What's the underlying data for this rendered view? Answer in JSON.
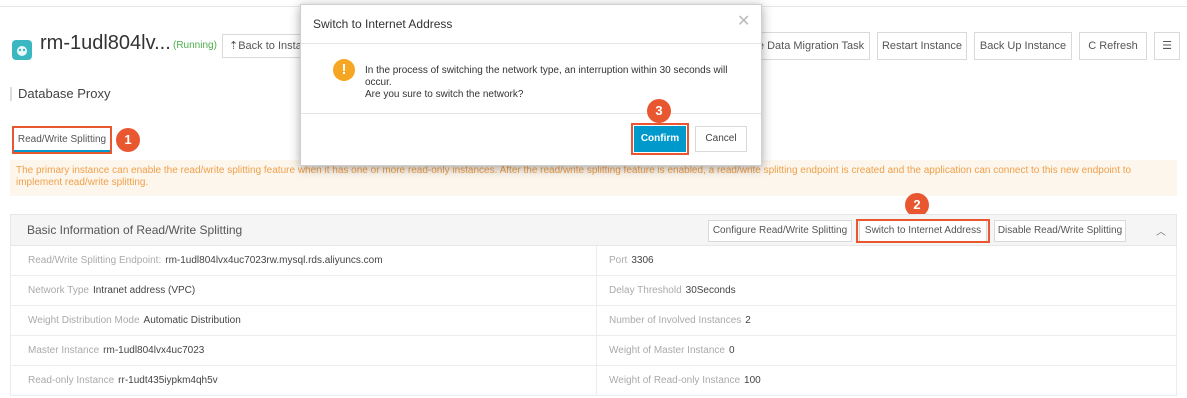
{
  "header": {
    "instance_name": "rm-1udl804lv...",
    "status": "(Running)",
    "back_label": "Back to Instances",
    "buttons": {
      "migrate": "Create Data Migration Task",
      "restart": "Restart Instance",
      "backup": "Back Up Instance",
      "refresh": "Refresh"
    }
  },
  "section": {
    "title": "Database Proxy"
  },
  "tabs": [
    {
      "label": "Read/Write Splitting"
    }
  ],
  "notice": "The primary instance can enable the read/write splitting feature when it has one or more read-only instances. After the read/write splitting feature is enabled, a read/write splitting endpoint is created and the application can connect to this new endpoint to implement read/write splitting.",
  "panel": {
    "title": "Basic Information of Read/Write Splitting",
    "buttons": {
      "configure": "Configure Read/Write Splitting",
      "switch": "Switch to Internet Address",
      "disable": "Disable Read/Write Splitting"
    },
    "rows": [
      {
        "left_label": "Read/Write Splitting Endpoint:",
        "left_value": "rm-1udl804lvx4uc7023rw.mysql.rds.aliyuncs.com",
        "right_label": "Port",
        "right_value": "3306"
      },
      {
        "left_label": "Network Type",
        "left_value": "Intranet address (VPC)",
        "right_label": "Delay Threshold",
        "right_value": "30Seconds"
      },
      {
        "left_label": "Weight Distribution Mode",
        "left_value": "Automatic Distribution",
        "right_label": "Number of Involved Instances",
        "right_value": "2"
      },
      {
        "left_label": "Master Instance",
        "left_value": "rm-1udl804lvx4uc7023",
        "right_label": "Weight of Master Instance",
        "right_value": "0"
      },
      {
        "left_label": "Read-only Instance",
        "left_value": "rr-1udt435iypkm4qh5v",
        "right_label": "Weight of Read-only Instance",
        "right_value": "100"
      }
    ]
  },
  "dialog": {
    "title": "Switch to Internet Address",
    "message_line1": "In the process of switching the network type, an interruption within 30 seconds will occur.",
    "message_line2": "Are you sure to switch the network?",
    "confirm": "Confirm",
    "cancel": "Cancel"
  },
  "callouts": {
    "one": "1",
    "two": "2",
    "three": "3"
  },
  "colors": {
    "accent": "#0099cc",
    "callout": "#e8572f",
    "warning": "#f5a623",
    "status": "#4cae4c"
  },
  "icons": {
    "instance": "database-icon",
    "warning": "exclamation-icon",
    "refresh": "refresh-icon",
    "list": "list-icon",
    "close": "close-icon",
    "collapse": "chevron-up-icon"
  }
}
